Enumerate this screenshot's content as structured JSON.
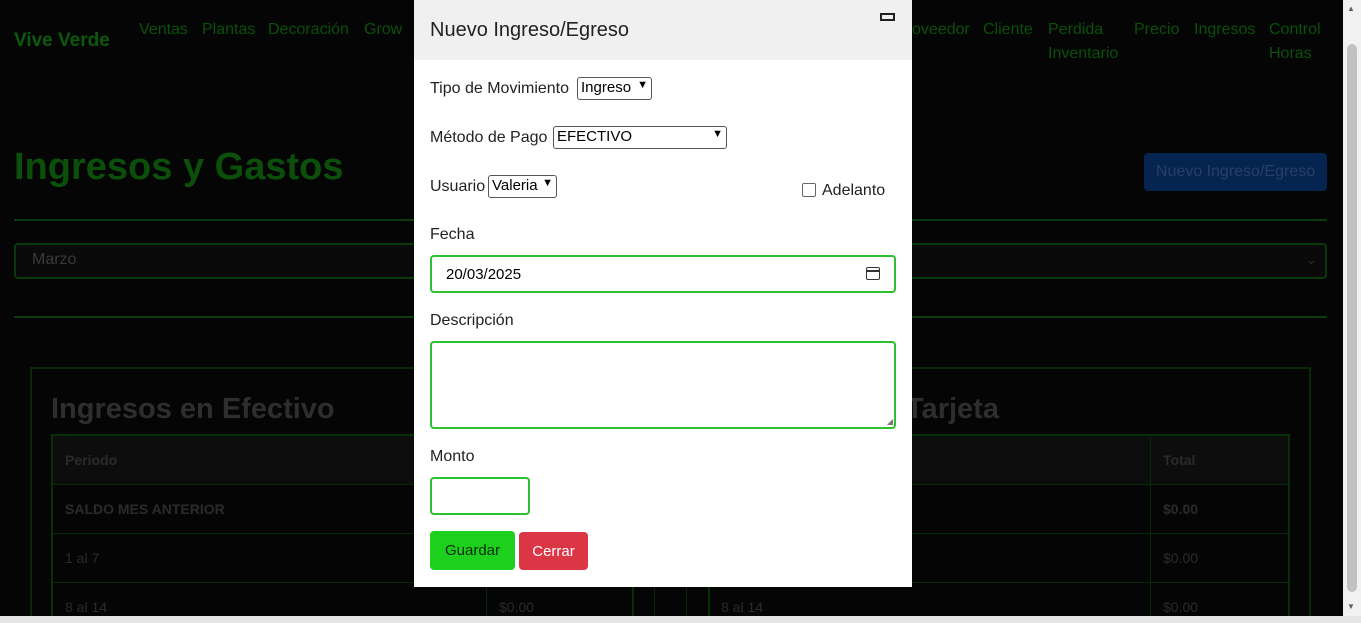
{
  "nav": {
    "brand": "Vive Verde",
    "items": [
      "Ventas",
      "Plantas",
      "Decoración",
      "Grow",
      "oveedor",
      "Cliente",
      "Perdida",
      "Inventario",
      "Precio",
      "Ingresos",
      "Control",
      "Horas"
    ]
  },
  "page": {
    "title": "Ingresos y Gastos",
    "new_button": "Nuevo Ingreso/Egreso",
    "month_value": "Marzo"
  },
  "cash_table": {
    "title": "Ingresos en Efectivo",
    "header_period": "Periodo",
    "rows": [
      "SALDO MES ANTERIOR",
      "1 al 7",
      "8 al 14"
    ],
    "col2_values": [
      "$0.00"
    ]
  },
  "card_table": {
    "title_fragment": "Tarjeta",
    "header_total": "Total",
    "totals": [
      "$0.00",
      "$0.00",
      "$0.00"
    ],
    "row3_period": "8 al 14"
  },
  "modal": {
    "title": "Nuevo Ingreso/Egreso",
    "tipo_label": "Tipo de Movimiento",
    "tipo_value": "Ingreso",
    "metodo_label": "Método de Pago",
    "metodo_value": "EFECTIVO",
    "usuario_label": "Usuario",
    "usuario_value": "Valeria",
    "adelanto_label": "Adelanto",
    "fecha_label": "Fecha",
    "fecha_value": "20/03/2025",
    "descripcion_label": "Descripción",
    "monto_label": "Monto",
    "save_label": "Guardar",
    "close_label": "Cerrar"
  }
}
